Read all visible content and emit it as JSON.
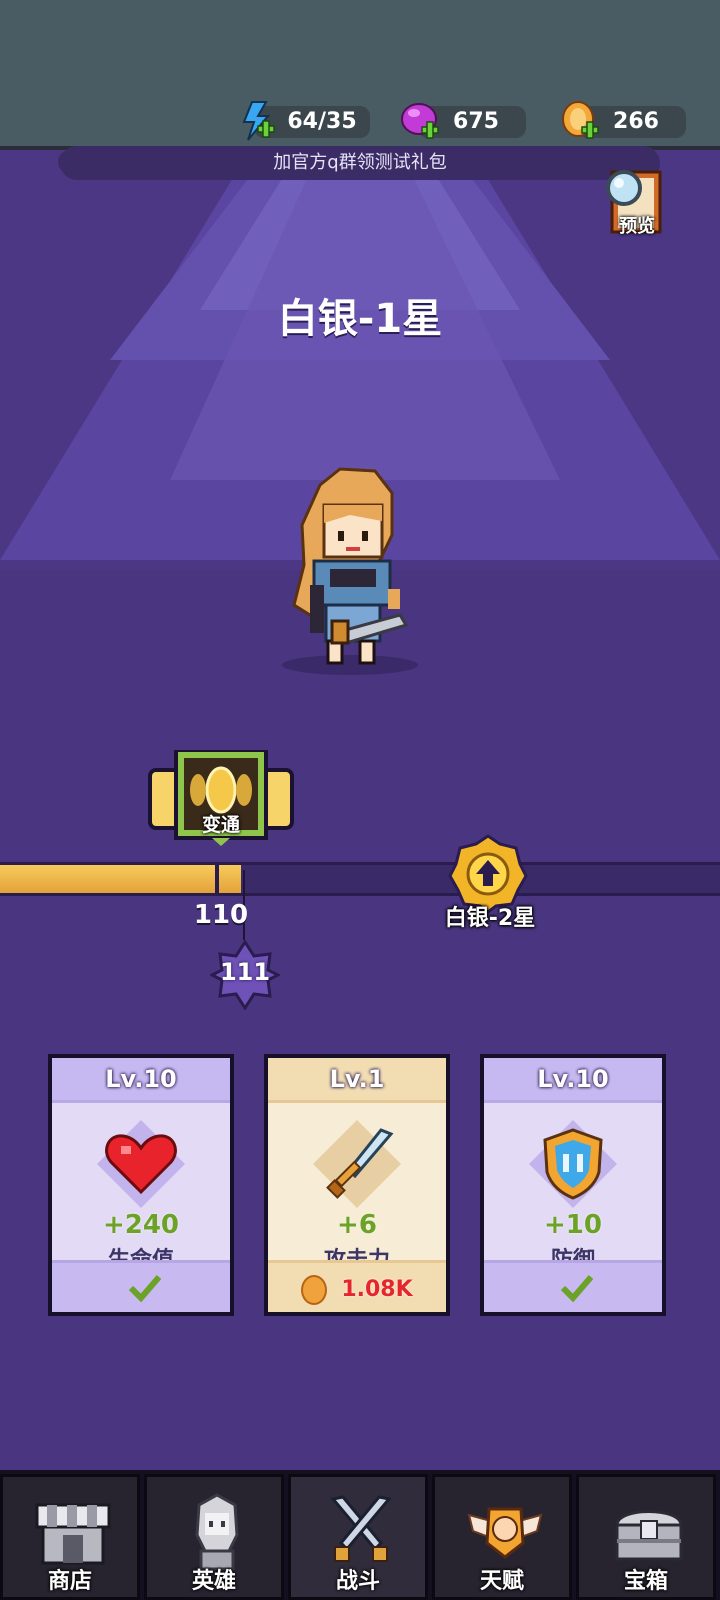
{
  "resources": {
    "energy": {
      "value": "64/35",
      "icon": "lightning-plus-icon"
    },
    "gems": {
      "value": "675",
      "icon": "gem-plus-icon"
    },
    "coins": {
      "value": "266",
      "icon": "coin-plus-icon"
    }
  },
  "banner": {
    "text": "加官方q群领测试礼包"
  },
  "preview": {
    "label": "预览",
    "icon": "magnifier-book-icon"
  },
  "rank": {
    "title": "白银-1星"
  },
  "hero": {
    "icon": "blonde-swordswoman-sprite"
  },
  "progress": {
    "fill_ratio": 0.335,
    "skill_label": "变通",
    "skill_icon": "golden-rings-skill-icon",
    "current_value": "110",
    "next_value": "111",
    "next_rank_label": "白银-2星",
    "next_rank_icon": "up-arrow-badge-icon"
  },
  "cards": [
    {
      "level": "Lv.10",
      "amount": "+240",
      "name": "生命值",
      "icon": "heart-icon",
      "status": "check-icon"
    },
    {
      "level": "Lv.1",
      "amount": "+6",
      "name": "攻击力",
      "icon": "sword-icon",
      "cost": "1.08K"
    },
    {
      "level": "Lv.10",
      "amount": "+10",
      "name": "防御",
      "icon": "shield-icon",
      "status": "check-icon"
    }
  ],
  "nav": [
    {
      "label": "商店",
      "icon": "shop-icon"
    },
    {
      "label": "英雄",
      "icon": "hero-icon"
    },
    {
      "label": "战斗",
      "icon": "crossed-swords-icon",
      "active": true
    },
    {
      "label": "天赋",
      "icon": "winged-fist-icon"
    },
    {
      "label": "宝箱",
      "icon": "treasure-chest-icon"
    }
  ],
  "colors": {
    "stage": "#4b3784",
    "topbar": "#4a5c63",
    "progress_fill": "#f1be4f",
    "amount_green": "#6ba227",
    "cost_red": "#e5262c"
  }
}
